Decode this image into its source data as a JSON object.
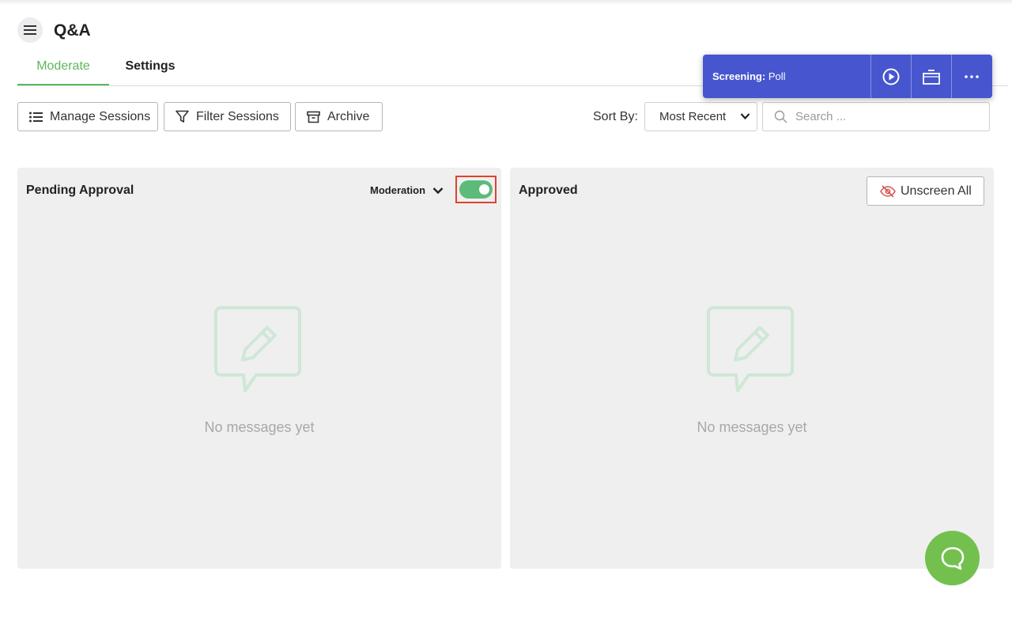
{
  "header": {
    "title": "Q&A"
  },
  "tabs": [
    {
      "label": "Moderate",
      "active": true
    },
    {
      "label": "Settings",
      "active": false
    }
  ],
  "toolbar": {
    "manage_label": "Manage Sessions",
    "filter_label": "Filter Sessions",
    "archive_label": "Archive",
    "sort_label": "Sort By:",
    "sort_value": "Most Recent",
    "search_placeholder": "Search ..."
  },
  "banner": {
    "prefix": "Screening:",
    "value": "Poll",
    "color": "#4756cf"
  },
  "pending": {
    "title": "Pending Approval",
    "moderation_label": "Moderation",
    "moderation_on": true,
    "empty_text": "No messages yet"
  },
  "approved": {
    "title": "Approved",
    "unscreen_label": "Unscreen All",
    "empty_text": "No messages yet"
  },
  "colors": {
    "accent": "#5cb85c",
    "toggle": "#5dbb7a",
    "highlight": "#e2412d",
    "fab": "#73c04f"
  },
  "icons": [
    "menu-icon",
    "list-icon",
    "filter-icon",
    "archive-icon",
    "search-icon",
    "play-icon",
    "screen-icon",
    "more-icon",
    "chevron-down-icon",
    "eye-off-icon",
    "edit-message-icon",
    "chat-icon"
  ]
}
